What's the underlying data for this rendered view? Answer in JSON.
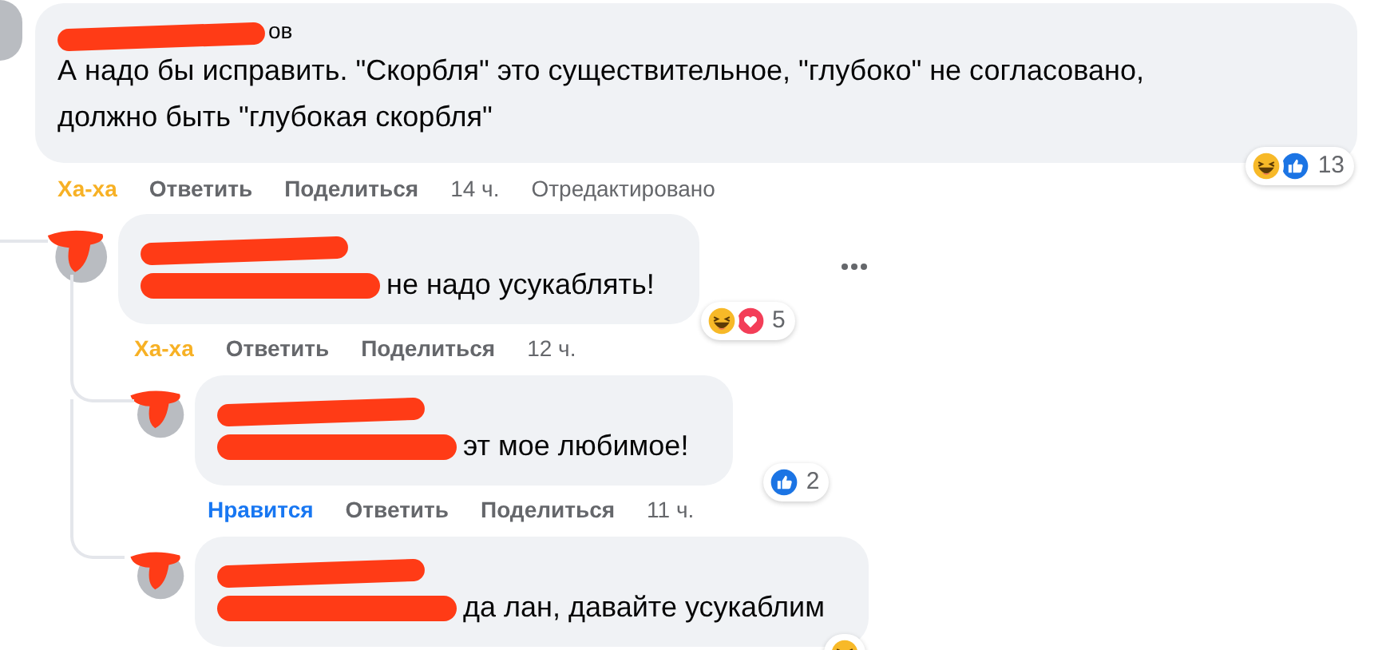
{
  "comments": [
    {
      "author_tail": "ов",
      "redacted_prefix": false,
      "text": "А надо бы исправить. \"Скорбля\" это существительное, \"глубоко\" не согласовано, должно быть \"глубокая скорбля\"",
      "reaction": {
        "kind": "haha",
        "label": "Ха-ха"
      },
      "actions": [
        "Ответить",
        "Поделиться"
      ],
      "time": "14 ч.",
      "edited": "Отредактировано",
      "reactions": {
        "icons": [
          {
            "kind": "haha"
          },
          {
            "kind": "like"
          }
        ],
        "count": "13"
      }
    },
    {
      "redacted_prefix": true,
      "text": "не надо усукаблять!",
      "reaction": {
        "kind": "haha",
        "label": "Ха-ха"
      },
      "actions": [
        "Ответить",
        "Поделиться"
      ],
      "time": "12 ч.",
      "menu": true,
      "reactions": {
        "icons": [
          {
            "kind": "haha"
          },
          {
            "kind": "love"
          }
        ],
        "count": "5"
      },
      "children": [
        {
          "redacted_prefix": true,
          "text": "эт мое любимое!",
          "reaction": {
            "kind": "like",
            "label": "Нравится"
          },
          "actions": [
            "Ответить",
            "Поделиться"
          ],
          "time": "11 ч.",
          "reactions": {
            "icons": [
              {
                "kind": "like"
              }
            ],
            "count": "2"
          }
        },
        {
          "redacted_prefix": true,
          "text": "да лан, давайте усукаблим",
          "reactions": {
            "icons": [
              {
                "kind": "haha"
              }
            ]
          }
        }
      ]
    }
  ]
}
